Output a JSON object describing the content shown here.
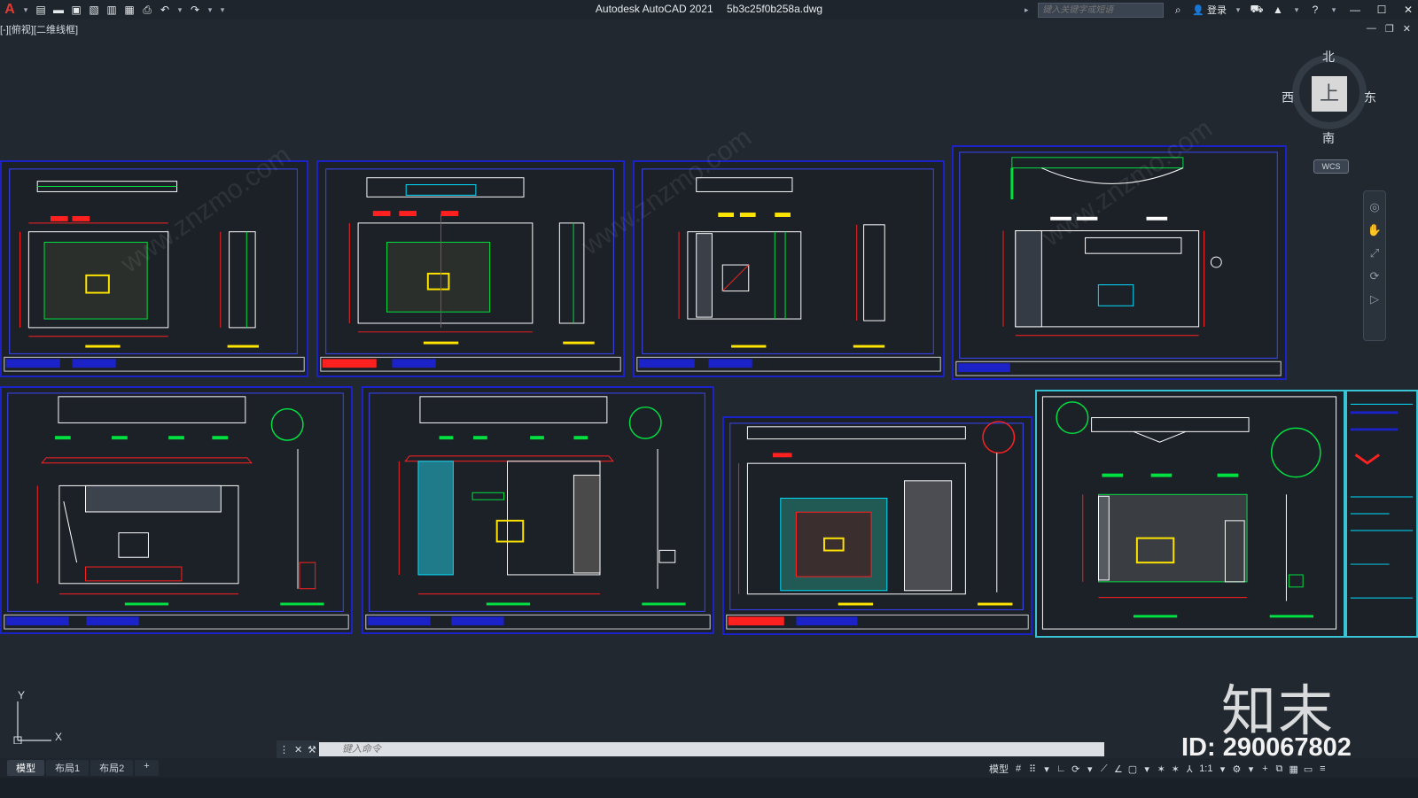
{
  "app": {
    "name": "Autodesk AutoCAD 2021",
    "file": "5b3c25f0b258a.dwg",
    "brand_color": "#e23b32"
  },
  "quick_access": {
    "logo": "A",
    "icons": [
      "new-file-icon",
      "open-folder-icon",
      "save-icon",
      "save-as-icon",
      "publish-icon",
      "plot-preview-icon",
      "print-icon",
      "undo-icon",
      "redo-icon",
      "customize-icon"
    ]
  },
  "search": {
    "placeholder": "键入关键字或短语"
  },
  "account": {
    "login_label": "登录"
  },
  "viewport_label": "[-][俯视][二维线框]",
  "viewcube": {
    "north": "北",
    "south": "南",
    "east": "东",
    "west": "西",
    "face": "上",
    "wcs": "WCS"
  },
  "ucs": {
    "x": "X",
    "y": "Y"
  },
  "command": {
    "placeholder": "键入命令"
  },
  "layout_tabs": [
    {
      "label": "模型",
      "active": true
    },
    {
      "label": "布局1",
      "active": false
    },
    {
      "label": "布局2",
      "active": false
    },
    {
      "label": "+",
      "active": false
    }
  ],
  "status": {
    "model_label": "模型",
    "scale": "1:1"
  },
  "watermark": {
    "logo_text": "知末",
    "id_text": "ID: 290067802",
    "diagonal_text": "www.znzmo.com"
  },
  "colors": {
    "sheet_border": "#1b22c8",
    "selected_border": "#39c4d6",
    "background": "#212830"
  }
}
